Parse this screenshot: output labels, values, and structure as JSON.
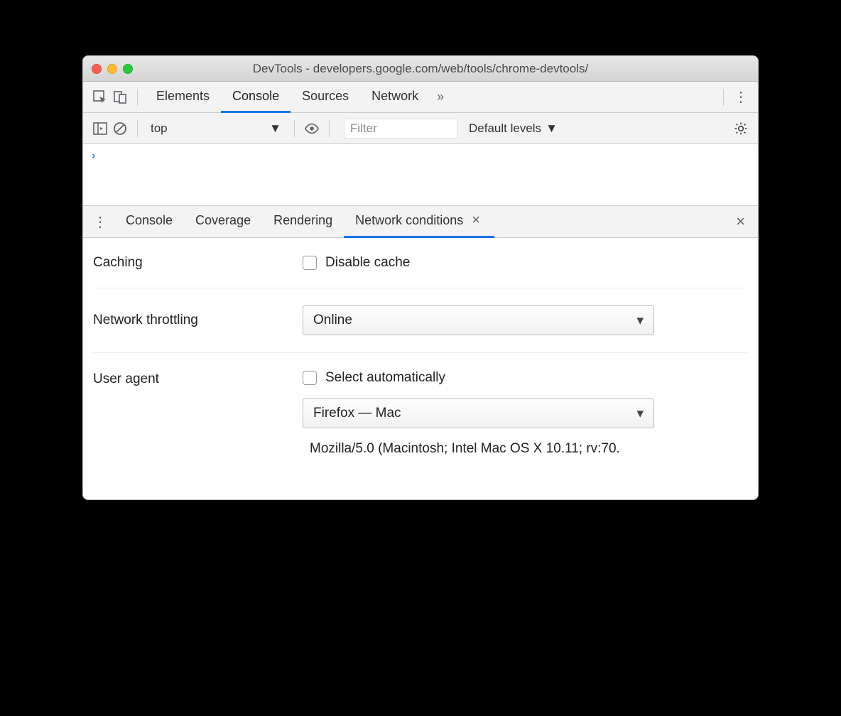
{
  "window": {
    "title": "DevTools - developers.google.com/web/tools/chrome-devtools/"
  },
  "tabs": {
    "elements": "Elements",
    "console": "Console",
    "sources": "Sources",
    "network": "Network"
  },
  "console_toolbar": {
    "context": "top",
    "filter_placeholder": "Filter",
    "levels": "Default levels"
  },
  "drawer": {
    "tabs": {
      "console": "Console",
      "coverage": "Coverage",
      "rendering": "Rendering",
      "network_conditions": "Network conditions"
    }
  },
  "network_conditions": {
    "caching_label": "Caching",
    "disable_cache_label": "Disable cache",
    "throttling_label": "Network throttling",
    "throttling_value": "Online",
    "user_agent_label": "User agent",
    "select_auto_label": "Select automatically",
    "ua_preset": "Firefox — Mac",
    "ua_string": "Mozilla/5.0 (Macintosh; Intel Mac OS X 10.11; rv:70."
  }
}
